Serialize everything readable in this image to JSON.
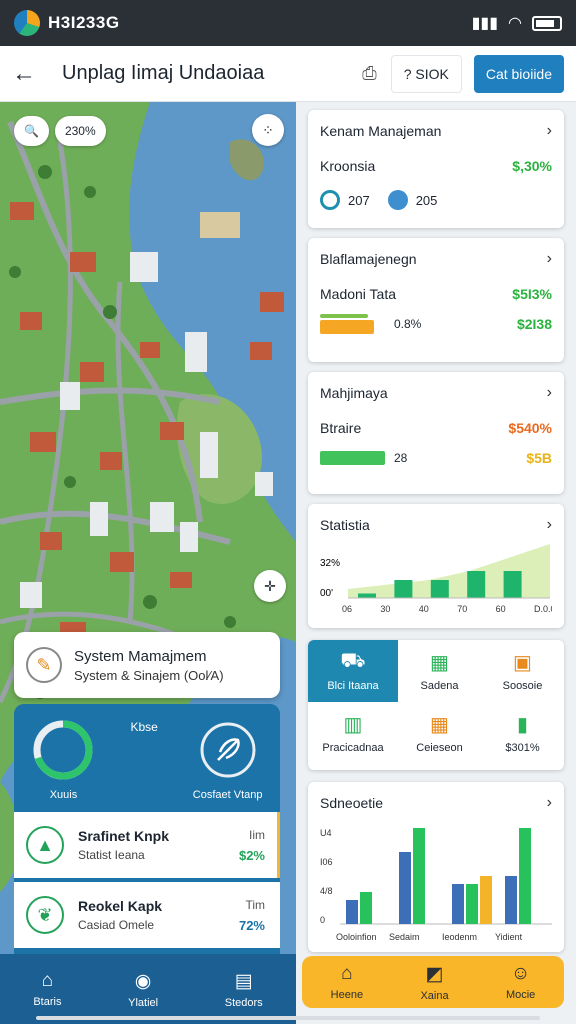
{
  "status": {
    "time": "H3I233G"
  },
  "header": {
    "title": "Unplag Iimaj Undaoiaa",
    "search_label": "? SIOK",
    "action_label": "Cat bioiide"
  },
  "map": {
    "zoom_label": "230%",
    "system_card": {
      "title": "System Mamajmem",
      "subtitle": "System & Sinajem (Ool⁄A)"
    },
    "gauges": [
      {
        "caption": "Kbse",
        "label": "Xuuis",
        "percent": 70
      },
      {
        "caption": "",
        "label": "Cosfaet Vtanp"
      }
    ],
    "kpis": [
      {
        "title": "Srafinet Knpk",
        "subtitle": "Statist Ieana",
        "right_top": "Iim",
        "right_value": "$2%",
        "value_color": "#23a35a"
      },
      {
        "title": "Reokel Kapk",
        "subtitle": "Casiad Omele",
        "right_top": "Tim",
        "right_value": "72%",
        "value_color": "#1b73a8"
      }
    ]
  },
  "cards": {
    "card1": {
      "title": "Kenam Manajeman",
      "row_label": "Kroonsia",
      "row_value": "$,30%",
      "stat_a": "207",
      "stat_b": "205"
    },
    "card2": {
      "title": "Blaflamajenegn",
      "row_label": "Madoni Tata",
      "row_value": "$5I3%",
      "bar_pct": "0.8%",
      "bar_value": "$2I38",
      "bar_fill": 0.8
    },
    "card3": {
      "title": "Mahjimaya",
      "row_label": "Btraire",
      "row_value": "$540%",
      "bar_label": "28",
      "bar_value": "$5B",
      "bar_fill": 0.95
    },
    "card4": {
      "title": "Statistia",
      "y_labels": [
        "32%",
        "00'"
      ],
      "x_labels": [
        "06",
        "30",
        "40",
        "70",
        "60",
        "D.0.0I"
      ]
    },
    "card5": {
      "title": "Sdneoetie",
      "y_labels": [
        "U4",
        "I06",
        "4/8",
        "0"
      ],
      "x_labels": [
        "Ooloinfion",
        "Sedaim",
        "Ieodenm",
        "Yidient"
      ]
    }
  },
  "tiles": [
    {
      "icon": "truck-icon",
      "label": "Blci Itaana",
      "active": true
    },
    {
      "icon": "cash-icon",
      "label": "Sadena",
      "active": false
    },
    {
      "icon": "box-icon",
      "label": "Soosoie",
      "active": false
    },
    {
      "icon": "building-icon",
      "label": "Pracicadnaa",
      "active": false
    },
    {
      "icon": "cash-icon",
      "label": "Ceieseon",
      "active": false
    },
    {
      "icon": "chart-icon",
      "label": "$301%",
      "active": false
    }
  ],
  "nav_left": [
    {
      "label": "Btaris"
    },
    {
      "label": "Ylatiel"
    },
    {
      "label": "Stedors"
    }
  ],
  "nav_right": [
    {
      "label": "Heene"
    },
    {
      "label": "Xaina"
    },
    {
      "label": "Mocie"
    }
  ],
  "chart_data": [
    {
      "type": "bar",
      "title": "Statistia",
      "categories": [
        "06",
        "30",
        "40",
        "70",
        "60"
      ],
      "series": [
        {
          "values": [
            1,
            4,
            4,
            6,
            6
          ],
          "color": "#1fb46b"
        }
      ],
      "area_trend": [
        2,
        3,
        4,
        6,
        9,
        12
      ],
      "ylim": [
        0,
        12
      ]
    },
    {
      "type": "bar",
      "title": "Sdneoetie",
      "categories": [
        "Ooloinfion",
        "Sedaim",
        "Ieodenm",
        "Yidient"
      ],
      "series": [
        {
          "values": [
            3,
            9,
            5,
            6
          ],
          "color": "#3c6fb8"
        },
        {
          "values": [
            4,
            12,
            5,
            12
          ],
          "color": "#27c25c"
        },
        {
          "values": [
            0,
            0,
            6,
            0
          ],
          "color": "#f3b42a"
        }
      ],
      "ylim": [
        0,
        13
      ]
    }
  ]
}
